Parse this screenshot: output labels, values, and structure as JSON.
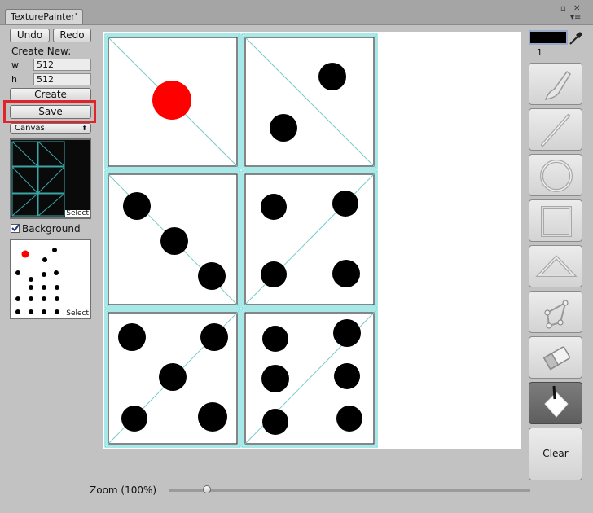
{
  "window": {
    "tab_title": "TexturePainter'",
    "ctrl_max": "▫",
    "ctrl_close": "✕",
    "ctrl_menu": "▾≡"
  },
  "toolbar": {
    "undo": "Undo",
    "redo": "Redo"
  },
  "create_new": {
    "title": "Create New:",
    "w_label": "w",
    "w_value": "512",
    "h_label": "h",
    "h_value": "512",
    "create": "Create"
  },
  "save": {
    "label": "Save"
  },
  "layer_select": {
    "selected": "Canvas"
  },
  "canvas_thumb": {
    "select": "Select"
  },
  "background": {
    "label": "Background",
    "checked": true,
    "select": "Select"
  },
  "color": {
    "swatch": "#000000",
    "brush_size": "1"
  },
  "tools": [
    {
      "name": "brush"
    },
    {
      "name": "line"
    },
    {
      "name": "circle"
    },
    {
      "name": "rectangle"
    },
    {
      "name": "triangle"
    },
    {
      "name": "polyline"
    },
    {
      "name": "eraser"
    },
    {
      "name": "fill",
      "active": true
    }
  ],
  "clear": {
    "label": "Clear"
  },
  "zoom": {
    "label": "Zoom (100%)",
    "value": 0.1
  },
  "accent": {
    "line": "#4fd0d0",
    "highlight": "#e0242c",
    "red_dot": "#ff0000"
  }
}
